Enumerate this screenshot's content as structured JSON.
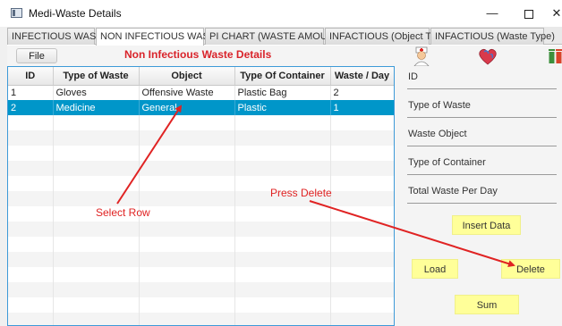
{
  "window": {
    "title": "Medi-Waste Details"
  },
  "tabs": [
    {
      "label": "INFECTIOUS WASTE"
    },
    {
      "label": "NON INFECTIOUS WASTE"
    },
    {
      "label": "PI CHART (WASTE AMOUNT)"
    },
    {
      "label": "INFACTIOUS (Object Type)"
    },
    {
      "label": "INFACTIOUS (Waste Type)"
    }
  ],
  "toolbar": {
    "file_label": "File",
    "heading": "Non Infectious Waste Details"
  },
  "table": {
    "columns": [
      "ID",
      "Type of Waste",
      "Object",
      "Type Of Container",
      "Waste / Day"
    ],
    "rows": [
      [
        "1",
        "Gloves",
        "Offensive Waste",
        "Plastic Bag",
        "2"
      ],
      [
        "2",
        "Medicine",
        "General",
        "Plastic",
        "1"
      ]
    ],
    "selected_row": 2
  },
  "form": {
    "fields": [
      "ID",
      "Type of Waste",
      "Waste Object",
      "Type of Container",
      "Total Waste Per Day"
    ],
    "insert_label": "Insert Data",
    "load_label": "Load",
    "delete_label": "Delete",
    "sum_label": "Sum"
  },
  "annotations": {
    "select_row": "Select Row",
    "press_delete": "Press Delete",
    "color": "#e02323"
  },
  "icons": [
    "nurse-icon",
    "heart-icon",
    "waste-bins-icon"
  ],
  "colors": {
    "selection": "#0096c9",
    "heading": "#d9232a",
    "button": "#ffff99",
    "table_border": "#3d9ad8"
  }
}
